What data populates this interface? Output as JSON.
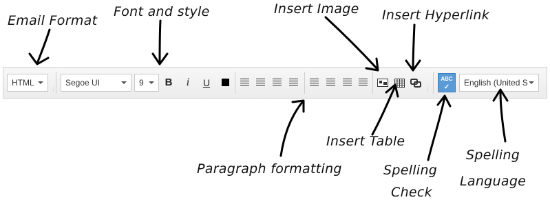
{
  "annotations": {
    "email_format": "Email Format",
    "font_and_style": "Font and style",
    "insert_image": "Insert Image",
    "insert_hyperlink": "Insert Hyperlink",
    "insert_table": "Insert Table",
    "paragraph_formatting": "Paragraph formatting",
    "spelling_check_line1": "Spelling",
    "spelling_check_line2": "Check",
    "spelling_language_line1": "Spelling",
    "spelling_language_line2": "Language"
  },
  "toolbar": {
    "format_value": "HTML",
    "font_value": "Segoe UI",
    "size_value": "9",
    "bold_label": "B",
    "italic_label": "i",
    "underline_label": "U",
    "spell_label": "ABC",
    "spell_check": "✓",
    "language_value": "English (United S",
    "text_color": "#000000",
    "spell_color": "#5b9bd5"
  },
  "icons": [
    "numbered-list-icon",
    "bullet-list-icon",
    "indent-icon",
    "outdent-icon",
    "align-left-icon",
    "align-center-icon",
    "align-right-icon",
    "justify-icon",
    "insert-image-icon",
    "insert-table-icon",
    "insert-hyperlink-icon",
    "spell-check-icon"
  ]
}
